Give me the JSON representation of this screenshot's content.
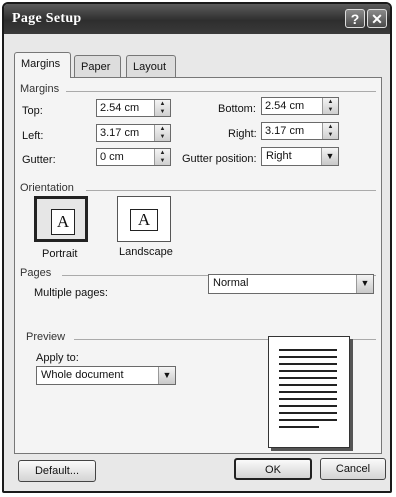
{
  "window": {
    "title": "Page Setup",
    "help_symbol": "?",
    "close_symbol": "✕"
  },
  "tabs": [
    {
      "label": "Margins",
      "active": true
    },
    {
      "label": "Paper",
      "active": false
    },
    {
      "label": "Layout",
      "active": false
    }
  ],
  "margins": {
    "heading": "Margins",
    "top_label": "Top:",
    "top_value": "2.54 cm",
    "bottom_label": "Bottom:",
    "bottom_value": "2.54 cm",
    "left_label": "Left:",
    "left_value": "3.17 cm",
    "right_label": "Right:",
    "right_value": "3.17 cm",
    "gutter_label": "Gutter:",
    "gutter_value": "0 cm",
    "gutter_position_label": "Gutter position:",
    "gutter_position_value": "Right"
  },
  "orientation": {
    "heading": "Orientation",
    "glyph": "A",
    "portrait_label": "Portrait",
    "landscape_label": "Landscape",
    "selected": "Portrait"
  },
  "pages": {
    "heading": "Pages",
    "multiple_pages_label": "Multiple pages:",
    "multiple_pages_value": "Normal"
  },
  "preview": {
    "heading": "Preview",
    "apply_to_label": "Apply to:",
    "apply_to_value": "Whole document"
  },
  "buttons": {
    "default": "Default...",
    "ok": "OK",
    "cancel": "Cancel"
  }
}
